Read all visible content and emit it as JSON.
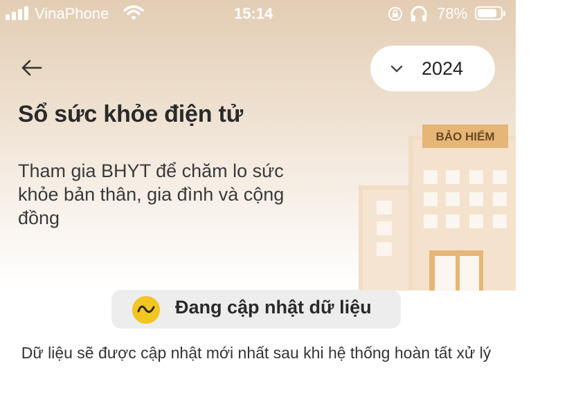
{
  "status_bar": {
    "carrier": "VinaPhone",
    "time": "15:14",
    "battery_percent": "78%"
  },
  "header": {
    "year_selected": "2024"
  },
  "hero": {
    "title": "Sổ sức khỏe điện tử",
    "description": "Tham gia BHYT để chăm lo sức khỏe bản thân, gia đình và cộng đồng",
    "building_sign": "BẢO HIỂM"
  },
  "update": {
    "label": "Đang cập nhật dữ liệu",
    "note": "Dữ liệu sẽ được cập nhật mới nhất sau khi hệ thống hoàn tất xử lý"
  },
  "colors": {
    "accent_yellow": "#f2c521",
    "hero_top": "#e3cdb4",
    "sign_bg": "#e6b676"
  }
}
